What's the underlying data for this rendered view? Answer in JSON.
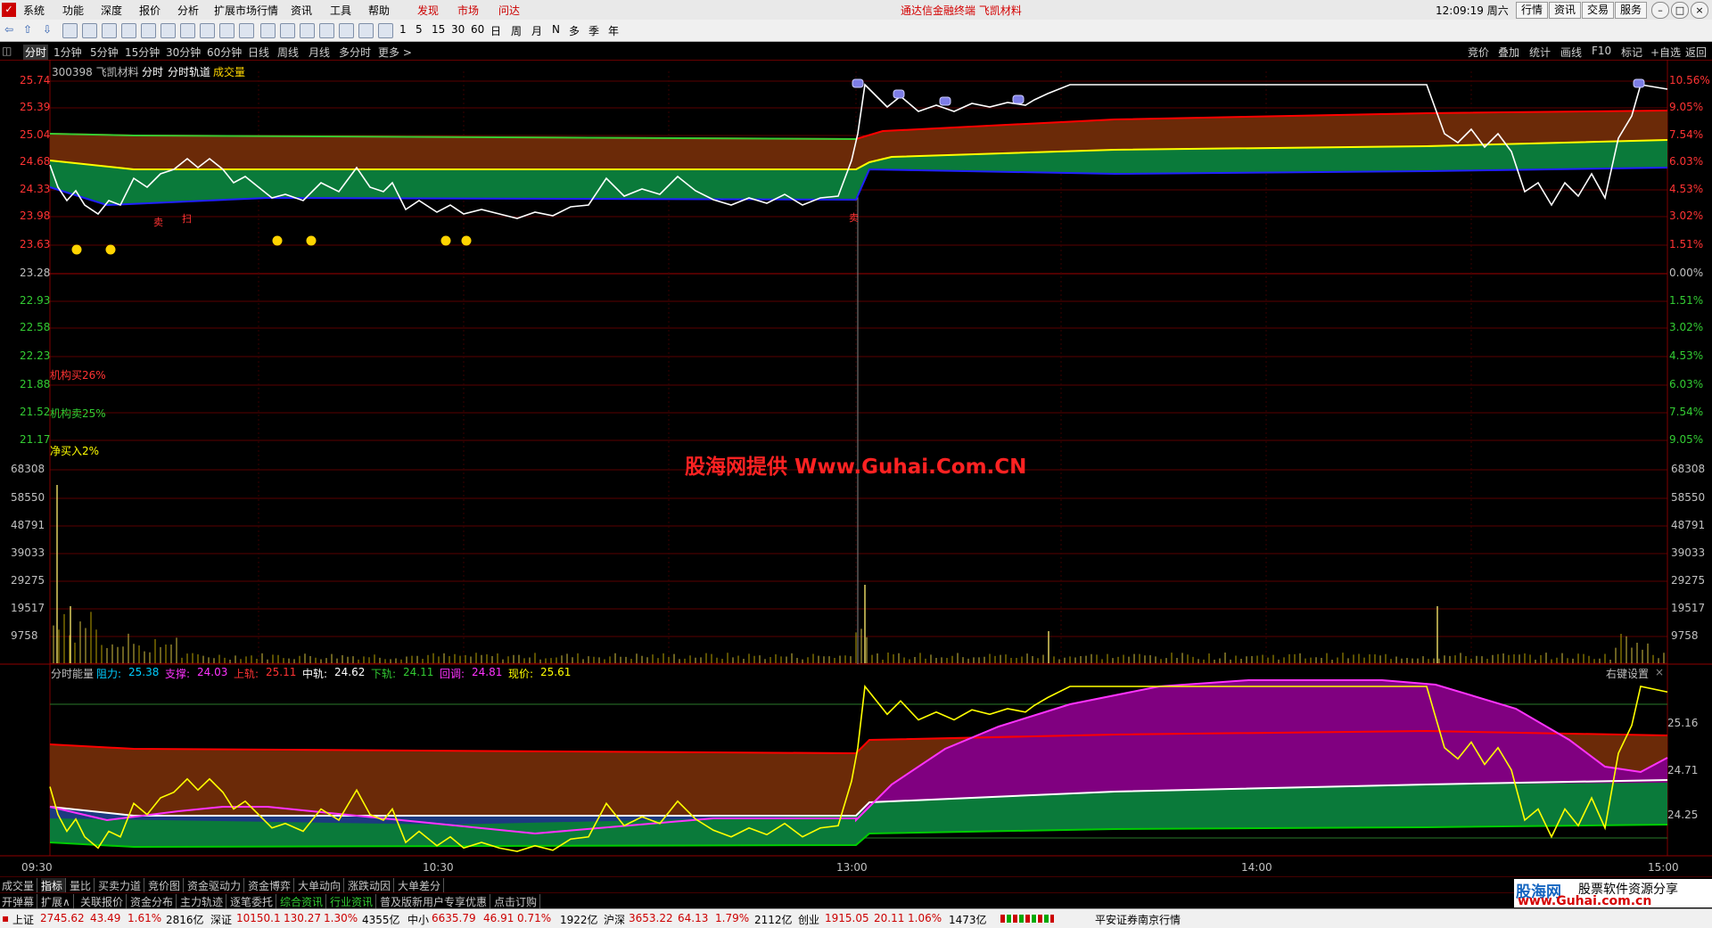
{
  "menu": {
    "logo": "✓",
    "items": [
      "系统",
      "功能",
      "深度",
      "报价",
      "分析",
      "扩展市场行情",
      "资讯",
      "工具",
      "帮助"
    ],
    "red_items": [
      "发现",
      "市场",
      "问达"
    ],
    "center_title": "通达信金融终端  飞凯材料",
    "clock": "12:09:19 周六",
    "right_buttons": [
      "行情",
      "资讯",
      "交易",
      "服务"
    ],
    "window_buttons": [
      "–",
      "□",
      "×"
    ]
  },
  "toolbar": {
    "periods": [
      "1",
      "5",
      "15",
      "30",
      "60",
      "日",
      "周",
      "月",
      "N",
      "多",
      "季",
      "年"
    ]
  },
  "period_bar": {
    "items": [
      "分时",
      "1分钟",
      "5分钟",
      "15分钟",
      "30分钟",
      "60分钟",
      "日线",
      "周线",
      "月线",
      "多分时",
      "更多 >"
    ],
    "selected": "分时",
    "right_items": [
      "竞价",
      "叠加",
      "统计",
      "画线",
      "F10",
      "标记",
      "+自选",
      "返回"
    ]
  },
  "chart": {
    "stock_header": "300398 飞凯材料",
    "header_items": [
      "分时",
      "分时轨道"
    ],
    "header_volume": "成交量",
    "price_labels": [
      "25.74",
      "25.39",
      "25.04",
      "24.68",
      "24.33",
      "23.98",
      "23.63",
      "23.28",
      "22.93",
      "22.58",
      "22.23",
      "21.88",
      "21.52",
      "21.17"
    ],
    "pct_labels": [
      "10.56%",
      "9.05%",
      "7.54%",
      "6.03%",
      "4.53%",
      "3.02%",
      "1.51%",
      "0.00%",
      "1.51%",
      "3.02%",
      "4.53%",
      "6.03%",
      "7.54%",
      "9.05%"
    ],
    "volume_labels": [
      "68308",
      "58550",
      "48791",
      "39033",
      "29275",
      "19517",
      "9758"
    ],
    "inst_buy": "机构买26%",
    "inst_sell": "机构卖25%",
    "net_buy": "净买入2%",
    "sell_mark": "卖",
    "scan_mark": "扫",
    "watermark": "股海网提供 Www.Guhai.Com.CN",
    "colors": {
      "up": "#ff3333",
      "down": "#33cc33",
      "price": "#ffffff",
      "upper": "#ff0000",
      "mid": "#ffff00",
      "lower": "#0000ff",
      "green_band": "#0a7a3a",
      "brown_band": "#6b2a08",
      "purple": "#800080"
    }
  },
  "chart_data": {
    "type": "line",
    "title": "300398 飞凯材料 分时",
    "x": [
      "09:30",
      "10:30",
      "13:00",
      "14:00",
      "15:00"
    ],
    "ylim": [
      21.17,
      25.74
    ],
    "price_close": 25.61,
    "volume_ylim": [
      0,
      68308
    ]
  },
  "energy": {
    "title": "分时能量",
    "items": [
      {
        "k": "阻力:",
        "v": "25.38",
        "color": "#00ccff"
      },
      {
        "k": "支撑:",
        "v": "24.03",
        "color": "#ff33ff"
      },
      {
        "k": "上轨:",
        "v": "25.11",
        "color": "#ff3333"
      },
      {
        "k": "中轨:",
        "v": "24.62",
        "color": "#ffffff"
      },
      {
        "k": "下轨:",
        "v": "24.11",
        "color": "#33cc33"
      },
      {
        "k": "回调:",
        "v": "24.81",
        "color": "#ff33ff"
      },
      {
        "k": "现价:",
        "v": "25.61",
        "color": "#ffff00"
      }
    ],
    "right_setting": "右键设置",
    "y_labels": [
      "25.16",
      "24.71",
      "24.25"
    ]
  },
  "time_axis": [
    "09:30",
    "10:30",
    "13:00",
    "14:00",
    "15:00"
  ],
  "tabs_row1": [
    "成交量",
    "指标",
    "量比",
    "买卖力道",
    "竞价图",
    "资金驱动力",
    "资金博弈",
    "大单动向",
    "涨跌动因",
    "大单差分"
  ],
  "tabs_row2": [
    "开弹幕",
    "扩展∧",
    "关联报价",
    "资金分布",
    "主力轨迹",
    "逐笔委托",
    "综合资讯",
    "行业资讯",
    "普及版新用户专享优惠",
    "点击订购"
  ],
  "status": {
    "sh": {
      "name": "上证",
      "val": "2745.62",
      "chg": "43.49",
      "pct": "1.61%",
      "amt": "2816亿"
    },
    "sz": {
      "name": "深证",
      "val": "10150.1",
      "chg": "130.27",
      "pct": "1.30%",
      "amt": "4355亿"
    },
    "zx": {
      "name": "中小",
      "val": "6635.79",
      "chg": "46.91",
      "pct": "0.71%",
      "amt": "1922亿"
    },
    "hs": {
      "name": "沪深",
      "val": "3653.22",
      "chg": "64.13",
      "pct": "1.79%",
      "amt": "2112亿"
    },
    "cy": {
      "name": "创业",
      "val": "1915.05",
      "chg": "20.11",
      "pct": "1.06%",
      "amt": "1473亿"
    },
    "broker": "平安证券南京行情"
  },
  "corner_logo": {
    "brand": "股海网",
    "slogan": "股票软件资源分享",
    "url": "www.Guhai.com.cn"
  }
}
